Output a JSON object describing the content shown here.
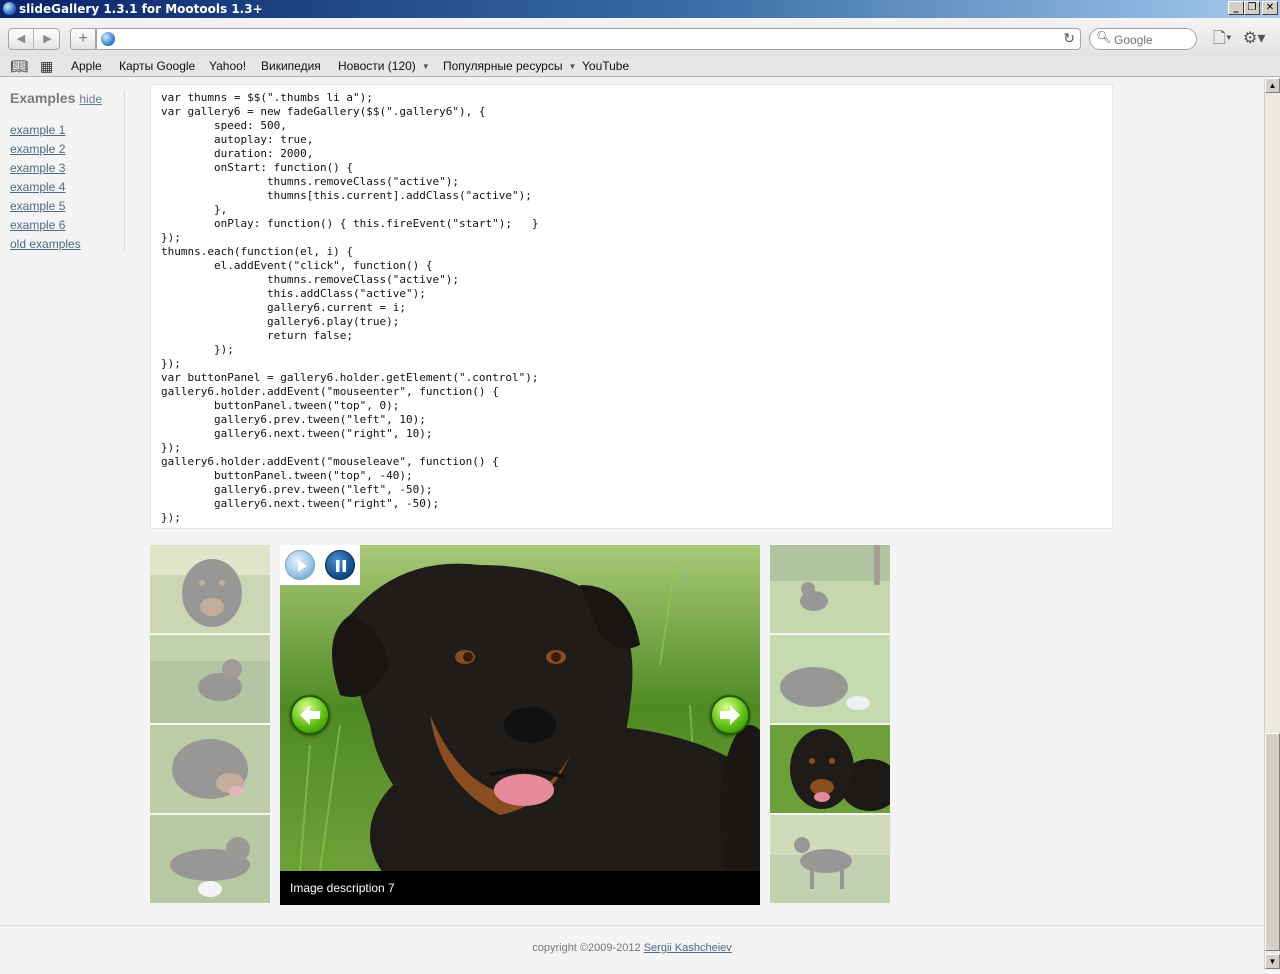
{
  "window": {
    "title": "slideGallery 1.3.1 for Mootools 1.3+"
  },
  "toolbar": {
    "url": "",
    "search_placeholder": "Google"
  },
  "bookmarks": [
    {
      "label": "Apple"
    },
    {
      "label": "Карты Google"
    },
    {
      "label": "Yahoo!"
    },
    {
      "label": "Википедия"
    },
    {
      "label": "Новости (120)",
      "menu": true
    },
    {
      "label": "Популярные ресурсы",
      "menu": true
    },
    {
      "label": "YouTube"
    }
  ],
  "sidebar": {
    "heading": "Examples",
    "hide_label": "hide",
    "items": [
      {
        "label": "example 1"
      },
      {
        "label": "example 2"
      },
      {
        "label": "example 3"
      },
      {
        "label": "example 4"
      },
      {
        "label": "example 5"
      },
      {
        "label": "example 6"
      },
      {
        "label": "old examples"
      }
    ]
  },
  "code": {
    "text": "var thumns = $$(\".thumbs li a\");\nvar gallery6 = new fadeGallery($$(\".gallery6\"), {\n        speed: 500,\n        autoplay: true,\n        duration: 2000,\n        onStart: function() {\n                thumns.removeClass(\"active\");\n                thumns[this.current].addClass(\"active\");\n        },\n        onPlay: function() { this.fireEvent(\"start\");   }\n});\nthumns.each(function(el, i) {\n        el.addEvent(\"click\", function() {\n                thumns.removeClass(\"active\");\n                this.addClass(\"active\");\n                gallery6.current = i;\n                gallery6.play(true);\n                return false;\n        });\n});\nvar buttonPanel = gallery6.holder.getElement(\".control\");\ngallery6.holder.addEvent(\"mouseenter\", function() {\n        buttonPanel.tween(\"top\", 0);\n        gallery6.prev.tween(\"left\", 10);\n        gallery6.next.tween(\"right\", 10);\n});\ngallery6.holder.addEvent(\"mouseleave\", function() {\n        buttonPanel.tween(\"top\", -40);\n        gallery6.prev.tween(\"left\", -50);\n        gallery6.next.tween(\"right\", -50);\n});"
  },
  "gallery": {
    "caption": "Image description 7",
    "active_thumb": 7
  },
  "footer": {
    "copyright": "copyright ©2009-2012 ",
    "author": "Sergii Kashcheiev"
  },
  "colors": {
    "link": "#4f6a86",
    "caption_bg": "#000000",
    "page_bg": "#f3f4f3"
  }
}
